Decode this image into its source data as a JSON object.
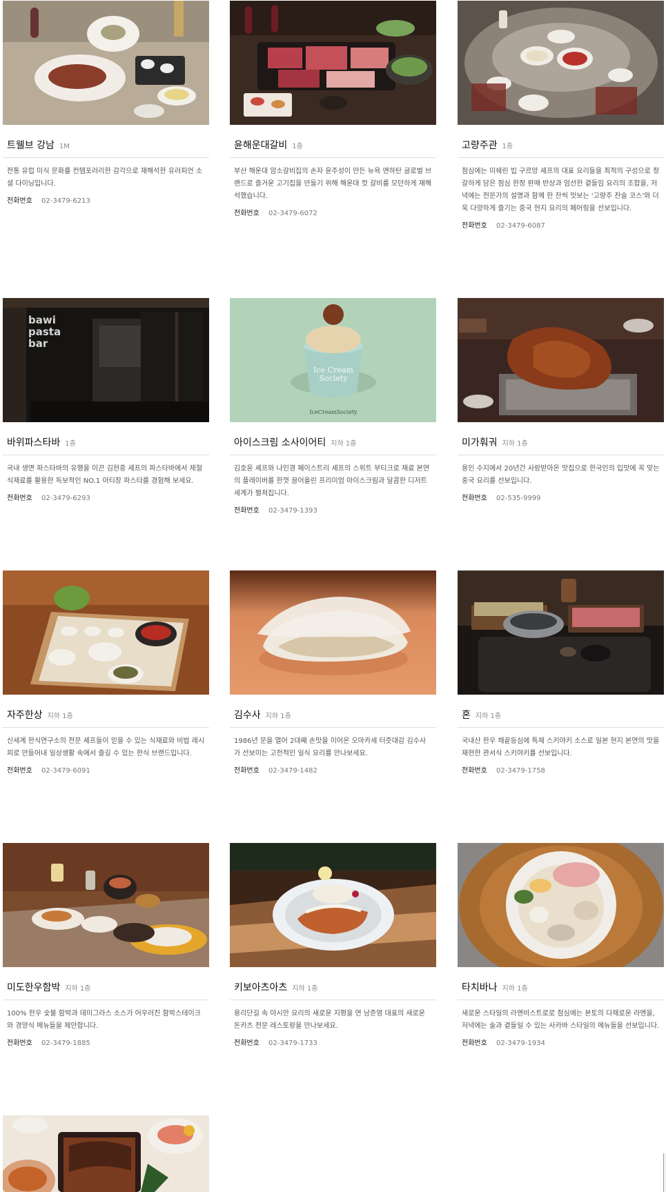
{
  "restaurants": [
    {
      "name": "트웰브 강남",
      "floor": "1M",
      "description": "전통 유럽 미식 문화를 컨템포러리한 감각으로 재해석한 유러피언 소셜 다이닝입니다.",
      "phone_label": "전화번호",
      "phone": "02-3479-6213",
      "photo": "steak-plates-photo"
    },
    {
      "name": "윤해운대갈비",
      "floor": "1층",
      "description": "부산 해운대 암소갈비집의 손자 윤주성이 만든 뉴욕 맨하탄 글로벌 브랜드로 즐거운 고기집을 만들기 위해 해운대 컷 갈비를 모던하게 재해석했습니다.",
      "phone_label": "전화번호",
      "phone": "02-3479-6072",
      "photo": "bbq-meat-platter-photo"
    },
    {
      "name": "고량주관",
      "floor": "1층",
      "description": "점심에는 미쉐린 빕 구르망 셰프의 대표 요리들을 최적의 구성으로 정갈하게 담은 점심 한정 판매 반상과 엄선한 곁들임 요리의 조합을, 저녁에는 전문가의 설명과 함께 한 잔씩 맛보는 '고량주 잔술 코스'와 더욱 다양하게 즐기는 중국 현지 요리의 페어링을 선보입니다.",
      "phone_label": "전화번호",
      "phone": "02-3479-6087",
      "photo": "chinese-table-photo"
    },
    {
      "name": "바위파스타바",
      "floor": "1층",
      "description": "국내 생면 파스타바의 유행을 이끈 김현중 셰프의 파스타바에서 제철 식재료를 활용한 독보적인 NO.1 아티장 파스타를 경험해 보세요.",
      "phone_label": "전화번호",
      "phone": "02-3479-6293",
      "photo": "pasta-bar-interior-photo",
      "sign": [
        "bawi",
        "pasta",
        "bar"
      ]
    },
    {
      "name": "아이스크림 소사이어티",
      "floor": "지하 1층",
      "description": "김호윤 셰프와 나인경 페이스트리 셰프의 스위트 부티크로 재료 본연의 플레이버를 한껏 끌어올린 프리미엄 아이스크림과 달콤한 디저트 세계가 펼쳐집니다.",
      "phone_label": "전화번호",
      "phone": "02-3479-1393",
      "photo": "ice-cream-cup-photo",
      "sign": [
        "Ice Cream",
        "Society",
        "IceCreamSociety"
      ]
    },
    {
      "name": "미가훠궈",
      "floor": "지하 1층",
      "description": "용인 수지에서 20년간 사랑받아온 맛집으로 한국인의 입맛에 꼭 맞는 중국 요리를 선보입니다.",
      "phone_label": "전화번호",
      "phone": "02-535-9999",
      "photo": "roast-lamb-photo"
    },
    {
      "name": "자주한상",
      "floor": "지하 1층",
      "description": "신세계 한식연구소의 전문 셰프들이 믿을 수 있는 식재료와 비법 레시피로 만들어내 일상생활 속에서 즐길 수 있는 한식 브랜드입니다.",
      "phone_label": "전화번호",
      "phone": "02-3479-6091",
      "photo": "korean-tray-photo"
    },
    {
      "name": "김수사",
      "floor": "지하 1층",
      "description": "1986년 문을 열어 2대째 손맛을 이어온 오마카세 터줏대감 김수사가 선보이는 고전적인 일식 요리를 만나보세요.",
      "phone_label": "전화번호",
      "phone": "02-3479-1482",
      "photo": "sushi-nigiri-photo"
    },
    {
      "name": "혼",
      "floor": "지하 1층",
      "description": "국내산 한우 채끝등심에 특제 스키야키 소스로 일본 현지 본연의 맛을 재현한 관서식 스키야키를 선보입니다.",
      "phone_label": "전화번호",
      "phone": "02-3479-1758",
      "photo": "sukiyaki-set-photo"
    },
    {
      "name": "미도한우함박",
      "floor": "지하 1층",
      "description": "100% 한우 숯불 함박과 데미그라스 소스가 어우러진 함박스테이크와 경양식 메뉴들을 제안합니다.",
      "phone_label": "전화번호",
      "phone": "02-3479-1885",
      "photo": "hamburg-steak-table-photo"
    },
    {
      "name": "키보아츠아츠",
      "floor": "지하 1층",
      "description": "용리단길 속 아시안 요리의 새로운 지평을 연 남준영 대표의 새로운 돈카츠 전문 레스토랑을 만나보세요.",
      "phone_label": "전화번호",
      "phone": "02-3479-1733",
      "photo": "tonkatsu-plate-photo"
    },
    {
      "name": "타치바나",
      "floor": "지하 1층",
      "description": "새로운 스타일의 라멘비스트로로 점심에는 본토의 다채로운 라멘을, 저녁에는 술과 곁들일 수 있는 사카바 스타일의 메뉴들을 선보입니다.",
      "phone_label": "전화번호",
      "phone": "02-3479-1934",
      "photo": "ramen-bowl-photo"
    },
    {
      "name": "",
      "floor": "",
      "description": "",
      "phone_label": "",
      "phone": "",
      "photo": "unagi-don-photo"
    }
  ]
}
